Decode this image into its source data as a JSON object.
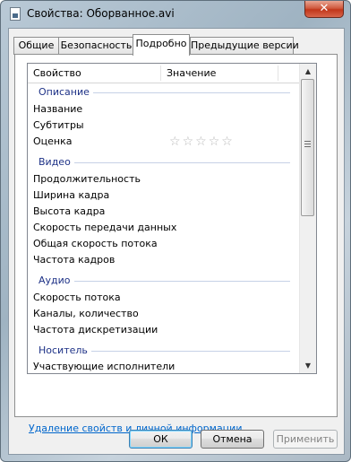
{
  "window": {
    "title": "Свойства: Оборванное.avi"
  },
  "titlebar": {
    "close_glyph": "✕"
  },
  "tabs": [
    {
      "label": "Общие"
    },
    {
      "label": "Безопасность"
    },
    {
      "label": "Подробно",
      "active": true
    },
    {
      "label": "Предыдущие версии"
    }
  ],
  "details": {
    "columns": {
      "property": "Свойство",
      "value": "Значение"
    },
    "groups": {
      "description": {
        "label": "Описание",
        "rows": [
          "Название",
          "Субтитры",
          "Оценка"
        ]
      },
      "video": {
        "label": "Видео",
        "rows": [
          "Продолжительность",
          "Ширина кадра",
          "Высота кадра",
          "Скорость передачи данных",
          "Общая скорость потока",
          "Частота кадров"
        ]
      },
      "audio": {
        "label": "Аудио",
        "rows": [
          "Скорость потока",
          "Каналы, количество",
          "Частота дискретизации"
        ]
      },
      "media": {
        "label": "Носитель",
        "rows": [
          "Участвующие исполнители"
        ]
      }
    },
    "rating": {
      "stars_total": 5,
      "stars_filled": 0,
      "star_glyph": "☆"
    },
    "scrollbar": {
      "up_glyph": "▲",
      "down_glyph": "▼"
    }
  },
  "remove_link": "Удаление свойств и личной информации",
  "buttons": {
    "ok": "ОК",
    "cancel": "Отмена",
    "apply": "Применить"
  }
}
